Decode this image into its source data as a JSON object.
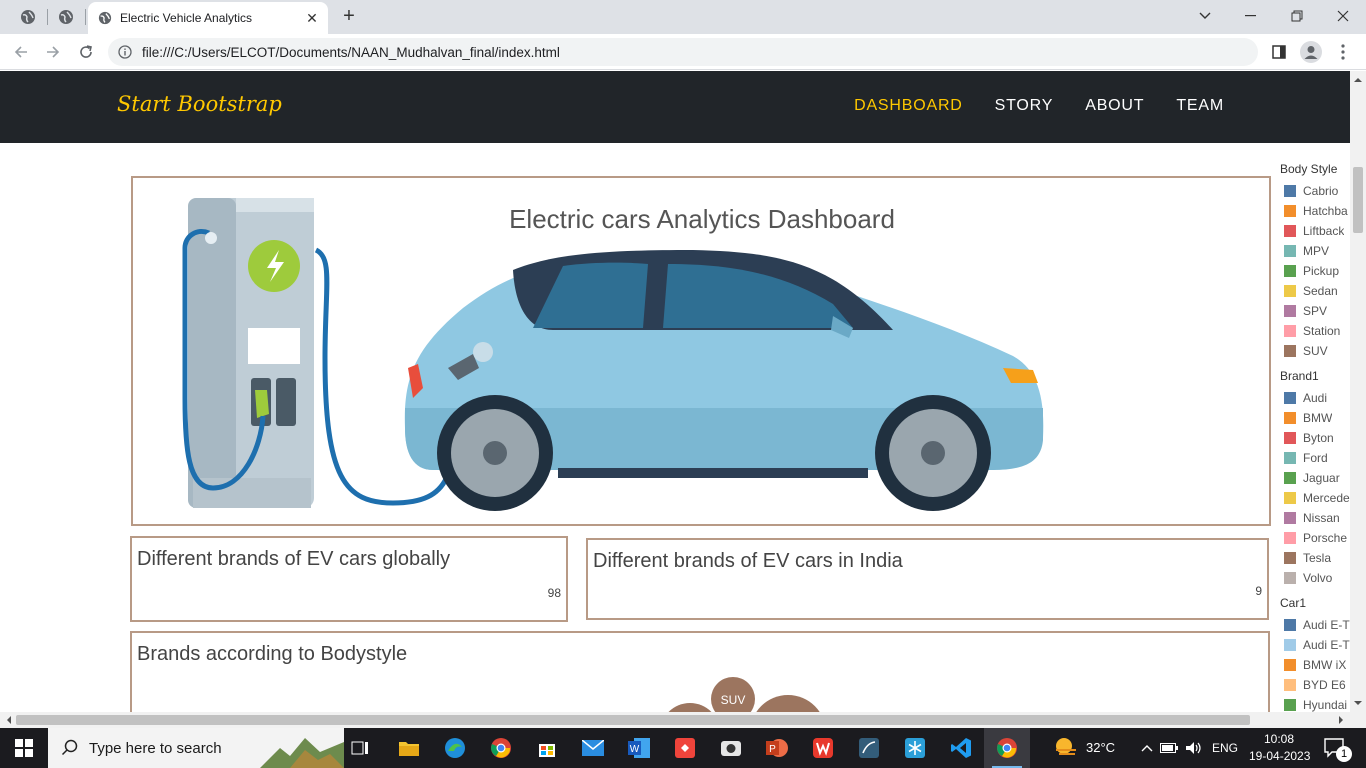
{
  "browser": {
    "tab_title": "Electric Vehicle Analytics",
    "url": "file:///C:/Users/ELCOT/Documents/NAAN_Mudhalvan_final/index.html"
  },
  "site": {
    "brand": "Start Bootstrap",
    "nav": [
      "DASHBOARD",
      "STORY",
      "ABOUT",
      "TEAM"
    ],
    "active_nav": "DASHBOARD"
  },
  "dashboard": {
    "title": "Electric cars Analytics Dashboard",
    "kpi_global": {
      "title": "Different brands of EV cars globally",
      "value": "98"
    },
    "kpi_india": {
      "title": "Different brands of EV cars in India",
      "value": "9"
    },
    "bodystyle_panel": {
      "title": "Brands according to Bodystyle",
      "bubble_label": "SUV"
    }
  },
  "legend": {
    "body_style": {
      "title": "Body Style",
      "items": [
        {
          "label": "Cabrio",
          "color": "#4e79a7"
        },
        {
          "label": "Hatchba",
          "color": "#f28e2b"
        },
        {
          "label": "Liftback",
          "color": "#e15759"
        },
        {
          "label": "MPV",
          "color": "#76b7b2"
        },
        {
          "label": "Pickup",
          "color": "#59a14f"
        },
        {
          "label": "Sedan",
          "color": "#edc948"
        },
        {
          "label": "SPV",
          "color": "#b07aa1"
        },
        {
          "label": "Station",
          "color": "#ff9da7"
        },
        {
          "label": "SUV",
          "color": "#9c755f"
        }
      ]
    },
    "brand": {
      "title": "Brand1",
      "items": [
        {
          "label": "Audi",
          "color": "#4e79a7"
        },
        {
          "label": "BMW",
          "color": "#f28e2b"
        },
        {
          "label": "Byton",
          "color": "#e15759"
        },
        {
          "label": "Ford",
          "color": "#76b7b2"
        },
        {
          "label": "Jaguar",
          "color": "#59a14f"
        },
        {
          "label": "Mercede",
          "color": "#edc948"
        },
        {
          "label": "Nissan",
          "color": "#b07aa1"
        },
        {
          "label": "Porsche",
          "color": "#ff9da7"
        },
        {
          "label": "Tesla",
          "color": "#9c755f"
        },
        {
          "label": "Volvo",
          "color": "#bab0ac"
        }
      ]
    },
    "car": {
      "title": "Car1",
      "items": [
        {
          "label": "Audi E-T",
          "color": "#4e79a7"
        },
        {
          "label": "Audi E-T",
          "color": "#a0cbe8"
        },
        {
          "label": "BMW iX",
          "color": "#f28e2b"
        },
        {
          "label": "BYD E6",
          "color": "#ffbe7d"
        },
        {
          "label": "Hyundai",
          "color": "#59a14f"
        }
      ]
    }
  },
  "taskbar": {
    "search_placeholder": "Type here to search",
    "weather": "32°C",
    "language": "ENG",
    "time": "10:08",
    "date": "19-04-2023",
    "notification_count": "1"
  }
}
